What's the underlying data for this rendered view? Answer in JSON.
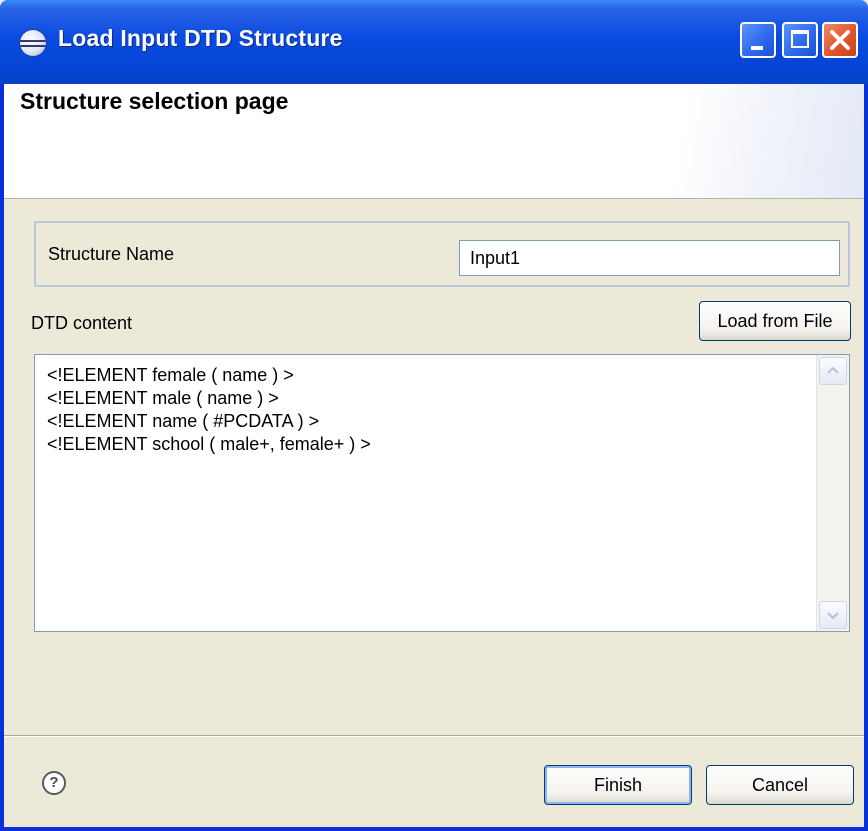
{
  "window": {
    "title": "Load Input DTD Structure",
    "title_icon": "eclipse-icon",
    "controls": [
      "minimize-icon",
      "maximize-icon",
      "close-icon"
    ]
  },
  "banner": {
    "title": "Structure selection page"
  },
  "form": {
    "structure_name_label": "Structure Name",
    "structure_name_value": "Input1",
    "dtd_content_label": "DTD content",
    "load_from_file_label": "Load from File",
    "dtd_lines": [
      "<!ELEMENT female ( name ) >",
      "<!ELEMENT male ( name ) >",
      "<!ELEMENT name ( #PCDATA ) >",
      "<!ELEMENT school ( male+, female+ ) >"
    ]
  },
  "footer": {
    "help_icon": "help-icon",
    "help_symbol": "?",
    "finish_label": "Finish",
    "cancel_label": "Cancel"
  },
  "colors": {
    "titlebar": "#0a4ae0",
    "dialog_background": "#ece9d8",
    "close_button": "#e0562d"
  }
}
